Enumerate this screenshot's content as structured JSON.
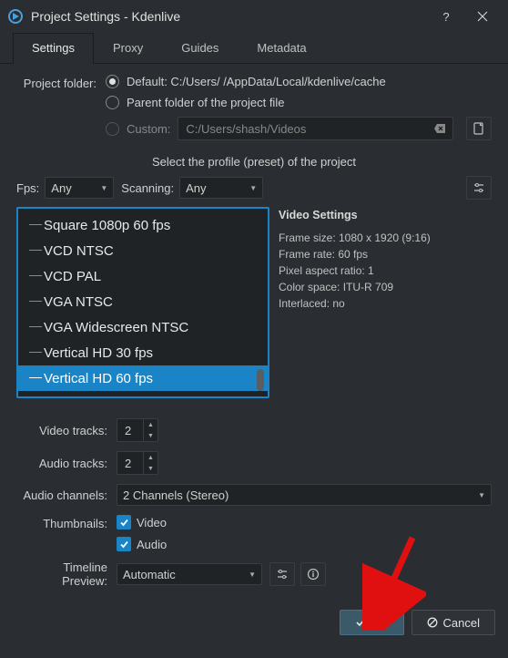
{
  "titlebar": {
    "title": "Project Settings - Kdenlive"
  },
  "tabs": [
    "Settings",
    "Proxy",
    "Guides",
    "Metadata"
  ],
  "project_folder": {
    "label": "Project folder:",
    "options": {
      "default": "Default: C:/Users/          /AppData/Local/kdenlive/cache",
      "parent": "Parent folder of the project file",
      "custom": "Custom:"
    },
    "custom_placeholder": "C:/Users/shash/Videos"
  },
  "profile_header": "Select the profile (preset) of the project",
  "fps": {
    "label": "Fps:",
    "value": "Any"
  },
  "scanning": {
    "label": "Scanning:",
    "value": "Any"
  },
  "profiles": [
    "Square 1080p 60 fps",
    "VCD NTSC",
    "VCD PAL",
    "VGA NTSC",
    "VGA Widescreen NTSC",
    "Vertical HD 30 fps",
    "Vertical HD 60 fps"
  ],
  "profiles_selected_index": 6,
  "video_settings": {
    "title": "Video Settings",
    "lines": [
      "Frame size: 1080 x 1920 (9:16)",
      "Frame rate: 60 fps",
      "Pixel aspect ratio: 1",
      "Color space: ITU-R 709",
      "Interlaced: no"
    ]
  },
  "video_tracks": {
    "label": "Video tracks:",
    "value": "2"
  },
  "audio_tracks": {
    "label": "Audio tracks:",
    "value": "2"
  },
  "audio_channels": {
    "label": "Audio channels:",
    "value": "2 Channels (Stereo)"
  },
  "thumbnails": {
    "label": "Thumbnails:",
    "video": "Video",
    "audio": "Audio"
  },
  "timeline_preview": {
    "label": "Timeline Preview:",
    "value": "Automatic"
  },
  "buttons": {
    "ok": "OK",
    "cancel": "Cancel"
  }
}
